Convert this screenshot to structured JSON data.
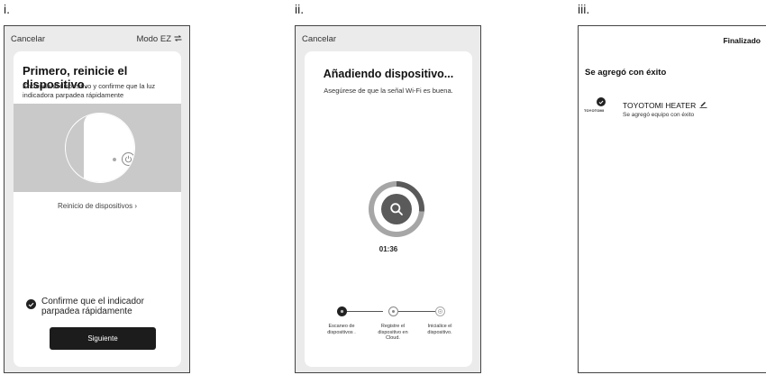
{
  "panels": {
    "i": {
      "label": "i.",
      "topbar": {
        "cancel": "Cancelar",
        "mode": "Modo EZ",
        "mode_icon": "swap-arrows-icon"
      },
      "title": "Primero, reinicie el dispositivo.",
      "description": "Encienda el dispositivo y confirme que la luz indicadora parpadea rápidamente",
      "reset_link": "Reinicio de dispositivos",
      "confirm_text": "Confirme que el indicador parpadea rápidamente",
      "next_button": "Siguiente"
    },
    "ii": {
      "label": "ii.",
      "topbar": {
        "cancel": "Cancelar"
      },
      "title": "Añadiendo dispositivo...",
      "description": "Asegúrese de que la señal Wi-Fi es buena.",
      "timer": "01:36",
      "steps": [
        {
          "label": "Escaneo de dispositivos .",
          "state": "active"
        },
        {
          "label": "Registre el dispositivo en Cloud.",
          "state": "pending"
        },
        {
          "label": "Inicialice el dispositivo.",
          "state": "pending"
        }
      ]
    },
    "iii": {
      "label": "iii.",
      "done_button": "Finalizado",
      "success_title": "Se agregó con éxito",
      "device_name": "TOYOTOMI HEATER",
      "device_logo_text": "TOYOTOMI",
      "device_status": "Se agregó equipo con éxito"
    }
  },
  "colors": {
    "screen_bg": "#ebebeb",
    "card_bg": "#ffffff",
    "primary_button": "#1c1c1c",
    "image_bg": "#c9c9c9"
  }
}
